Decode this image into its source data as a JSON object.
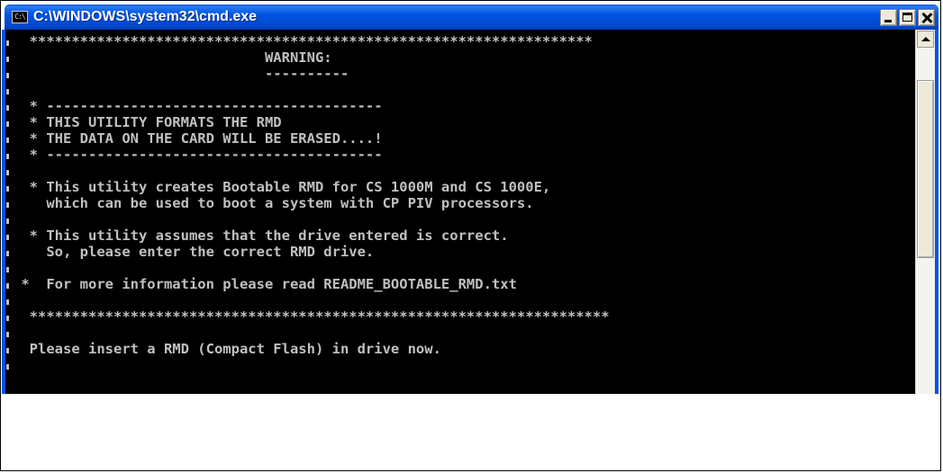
{
  "window": {
    "title": "C:\\WINDOWS\\system32\\cmd.exe",
    "icon_text": "C:\\",
    "titlebar_color": "#0054e3",
    "buttons": [
      "minimize",
      "maximize",
      "close"
    ]
  },
  "console": {
    "lines": [
      "  *******************************************************************",
      "                              WARNING:",
      "                              ----------",
      "",
      "  * ----------------------------------------",
      "  * THIS UTILITY FORMATS THE RMD",
      "  * THE DATA ON THE CARD WILL BE ERASED....!",
      "  * ----------------------------------------",
      "",
      "  * This utility creates Bootable RMD for CS 1000M and CS 1000E,",
      "    which can be used to boot a system with CP PIV processors.",
      "",
      "  * This utility assumes that the drive entered is correct.",
      "    So, please enter the correct RMD drive.",
      "",
      " *  For more information please read README_BOOTABLE_RMD.txt",
      "",
      "  *********************************************************************",
      "",
      "  Please insert a RMD (Compact Flash) in drive now.",
      ""
    ],
    "background": "#000000",
    "text_color": "#c0c0c0"
  },
  "scrollbar": {
    "up_arrow_icon": "arrow-up-icon"
  }
}
